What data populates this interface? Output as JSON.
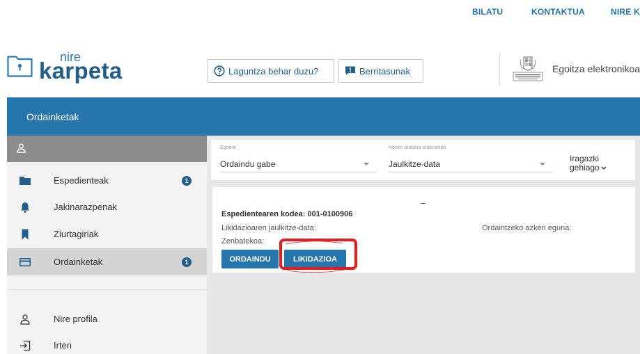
{
  "topnav": {
    "bilatu": "BILATU",
    "kontaktua": "KONTAKTUA",
    "nire": "NIRE K"
  },
  "logo": {
    "top": "nire",
    "bottom": "karpeta"
  },
  "header": {
    "help_button": "Laguntza behar duzu?",
    "news_button": "Berritasunak",
    "egoitza": "Egoitza elektronikoa"
  },
  "band": {
    "title": "Ordainketak"
  },
  "sidebar": {
    "items": [
      {
        "label": "Espedienteak",
        "badge": "1"
      },
      {
        "label": "Jakinarazpenak",
        "badge": ""
      },
      {
        "label": "Ziurtagiriak",
        "badge": ""
      },
      {
        "label": "Ordainketak",
        "badge": "1"
      }
    ],
    "profile": "Nire profila",
    "logout": "Irten"
  },
  "filters": {
    "status_label": "Egoera",
    "status_value": "Ordaindu gabe",
    "sort_label": "Honen arabera ordenatuta",
    "sort_value": "Jaulkitze-data",
    "more_line1": "Iragazki",
    "more_line2": "gehiago"
  },
  "card": {
    "code": "Espedientearen kodea: 001-0100906",
    "issue_date_label": "Likidazioaren jaulkitze-data:",
    "due_date_label": "Ordaintzeko azken eguna:",
    "amount_label": "Zenbatekoa:",
    "pay_button": "ORDAINDU",
    "liquidation_button": "LIKIDAZIOA"
  },
  "colors": {
    "primary": "#2676ad",
    "dark": "#215e8c",
    "highlight": "#e41e1e"
  }
}
